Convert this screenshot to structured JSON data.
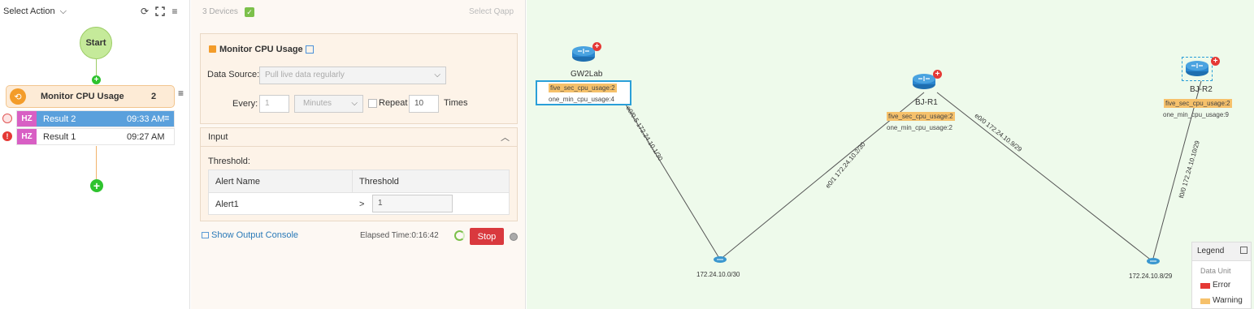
{
  "left_panel": {
    "select_action": "Select Action",
    "start_label": "Start",
    "step": {
      "title": "Monitor CPU Usage",
      "count": "2"
    },
    "results": [
      {
        "tag": "HZ",
        "name": "Result 2",
        "time": "09:33 AM"
      },
      {
        "tag": "HZ",
        "name": "Result 1",
        "time": "09:27 AM"
      }
    ]
  },
  "middle_panel": {
    "devices_count": "3 Devices",
    "select_qapp": "Select Qapp",
    "monitor_title": "Monitor CPU Usage",
    "data_source_label": "Data Source:",
    "data_source_value": "Pull live data regularly",
    "every_label": "Every:",
    "every_value": "1",
    "unit_value": "Minutes",
    "repeat_label": "Repeat",
    "repeat_value": "10",
    "times_label": "Times",
    "input_header": "Input",
    "threshold_label": "Threshold:",
    "table_headers": [
      "Alert Name",
      "Threshold"
    ],
    "table_rows": [
      {
        "alert": "Alert1",
        "op": ">",
        "value": "1"
      }
    ],
    "show_console": "Show Output Console",
    "elapsed": "Elapsed Time:0:16:42",
    "stop": "Stop"
  },
  "map": {
    "devices": [
      {
        "name": "GW2Lab",
        "five_sec": "five_sec_cpu_usage:2",
        "one_min": "one_min_cpu_usage:4"
      },
      {
        "name": "BJ-R1",
        "five_sec": "five_sec_cpu_usage:2",
        "one_min": "one_min_cpu_usage:2"
      },
      {
        "name": "BJ-R2",
        "five_sec": "five_sec_cpu_usage:2",
        "one_min": "one_min_cpu_usage:9"
      }
    ],
    "networks": [
      "172.24.10.0/30",
      "172.24.10.8/29"
    ],
    "links": [
      "e0/0.5 172.24.10.1/30",
      "e0/1 172.24.10.2/30",
      "e0/0 172.24.10.9/29",
      "f0/0 172.24.10.10/29"
    ]
  },
  "legend": {
    "title": "Legend",
    "data_unit": "Data Unit",
    "items": [
      {
        "label": "Error",
        "color": "#e53935"
      },
      {
        "label": "Warning",
        "color": "#f6c16b"
      }
    ]
  }
}
